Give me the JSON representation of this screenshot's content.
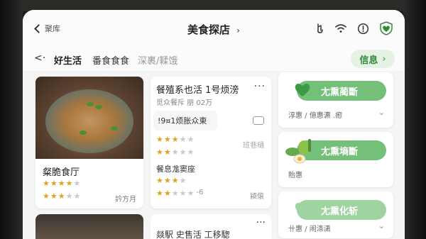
{
  "header": {
    "back_label": "聚库",
    "title": "美食探店",
    "title_chevron": "›"
  },
  "tabs": {
    "back_glyph": "<·",
    "items": [
      {
        "label": "好生活"
      },
      {
        "label": "番食食食"
      },
      {
        "label": "深裹/鞣饿"
      }
    ],
    "info_chip": {
      "label": "信息",
      "chevron": "›"
    }
  },
  "cards": {
    "left": {
      "name": "粲脆食厅",
      "rating1": 4,
      "rating2": 3,
      "meta": "訡方月"
    },
    "middle": {
      "name": "餐殖系也活 1号烦滂",
      "more": "···",
      "sub": "觅众餐斥  朋 02万",
      "popup_text": "!9¤1烦胀众東",
      "popup_sub": "· ·",
      "rating1": 3,
      "rating2": 2,
      "meta1": "班巷樋",
      "line2": "餐息尨窦座",
      "rating3": 3,
      "rating4": 2,
      "rating4_suffix": "-6",
      "meta2": "颍偯"
    },
    "right": [
      {
        "pill_label": "尢熏蔺斷",
        "sub": "淳惠 / 億惠瀌  .瘛",
        "chevron": "⌄"
      },
      {
        "pill_label": "尢熏墒斷",
        "sub": "貽惠",
        "chevron": ""
      },
      {
        "pill_label": "尢熏化斩",
        "sub": "卄惠 / 闹涤潇",
        "chevron": "⌄"
      }
    ],
    "bottom_middle": {
      "name": "燚駅 史售活 工移騘",
      "more": "···"
    }
  },
  "colors": {
    "accent_green": "#74bf7a",
    "star": "#e0a21b",
    "info_text": "#2f8a3a"
  }
}
